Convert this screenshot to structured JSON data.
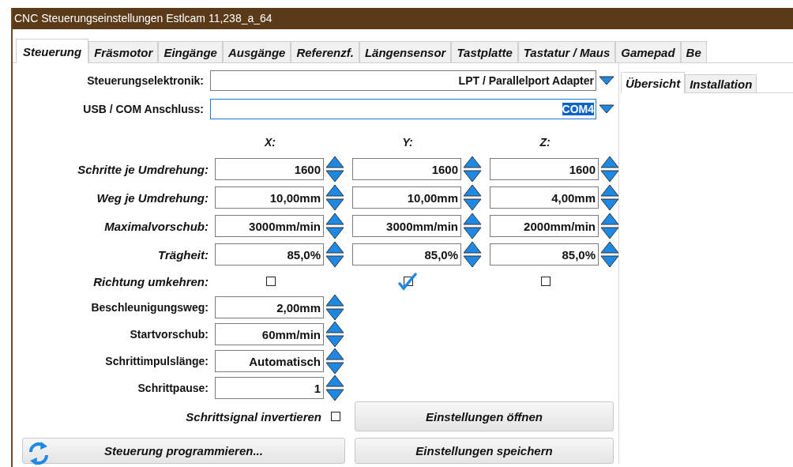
{
  "window": {
    "title": "CNC Steuerungseinstellungen Estlcam 11,238_a_64"
  },
  "tabs": [
    {
      "label": "Steuerung",
      "selected": true
    },
    {
      "label": "Fräsmotor",
      "selected": false
    },
    {
      "label": "Eingänge",
      "selected": false
    },
    {
      "label": "Ausgänge",
      "selected": false
    },
    {
      "label": "Referenzf.",
      "selected": false
    },
    {
      "label": "Längensensor",
      "selected": false
    },
    {
      "label": "Tastplatte",
      "selected": false
    },
    {
      "label": "Tastatur / Maus",
      "selected": false
    },
    {
      "label": "Gamepad",
      "selected": false
    },
    {
      "label": "Be",
      "selected": false
    }
  ],
  "dropdowns": [
    {
      "label": "Steuerungselektronik:",
      "value": "LPT / Parallelport Adapter",
      "focused": false
    },
    {
      "label": "USB / COM Anschluss:",
      "value": "COM4",
      "focused": true
    }
  ],
  "axis_headers": [
    "X:",
    "Y:",
    "Z:"
  ],
  "axis_rows": [
    {
      "label": "Schritte je Umdrehung:",
      "values": [
        "1600",
        "1600",
        "1600"
      ]
    },
    {
      "label": "Weg je Umdrehung:",
      "values": [
        "10,00mm",
        "10,00mm",
        "4,00mm"
      ]
    },
    {
      "label": "Maximalvorschub:",
      "values": [
        "3000mm/min",
        "3000mm/min",
        "2000mm/min"
      ]
    },
    {
      "label": "Trägheit:",
      "values": [
        "85,0%",
        "85,0%",
        "85,0%"
      ]
    }
  ],
  "reverse": {
    "label": "Richtung umkehren:",
    "checked": [
      false,
      true,
      false
    ]
  },
  "settings": [
    {
      "label": "Beschleunigungsweg:",
      "value": "2,00mm"
    },
    {
      "label": "Startvorschub:",
      "value": "60mm/min"
    },
    {
      "label": "Schrittimpulslänge:",
      "value": "Automatisch"
    },
    {
      "label": "Schrittpause:",
      "value": "1"
    }
  ],
  "invert": {
    "label": "Schrittsignal invertieren",
    "checked": false
  },
  "buttons": {
    "open": "Einstellungen öffnen",
    "program": "Steuerung programmieren...",
    "save": "Einstellungen speichern"
  },
  "side_tabs": [
    {
      "label": "Übersicht",
      "selected": true
    },
    {
      "label": "Installation",
      "selected": false
    }
  ]
}
